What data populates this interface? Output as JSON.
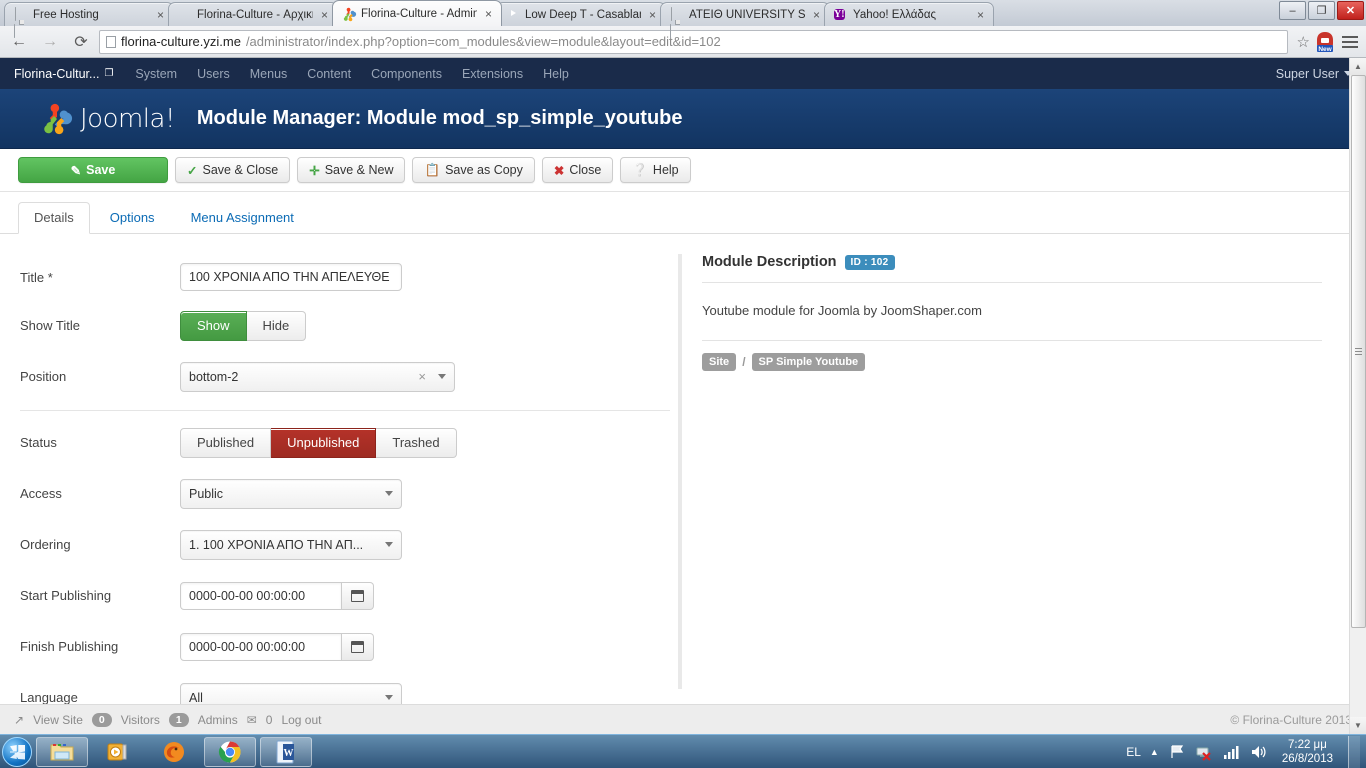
{
  "browser": {
    "tabs": [
      {
        "title": "Free Hosting",
        "icon": "document-favicon",
        "active": false
      },
      {
        "title": "Florina-Culture - Αρχικη",
        "icon": "opera-favicon",
        "active": false
      },
      {
        "title": "Florina-Culture - Administ",
        "icon": "joomla-favicon",
        "active": true
      },
      {
        "title": "Low Deep T - Casablanca",
        "icon": "youtube-favicon",
        "active": false
      },
      {
        "title": "ΑΤΕΙΘ UNIVERSITY STUDE",
        "icon": "document-favicon",
        "active": false
      },
      {
        "title": "Yahoo! Ελλάδας",
        "icon": "yahoo-favicon",
        "active": false
      }
    ],
    "close_label": "×",
    "window_controls": {
      "minimize": "–",
      "maximize": "❐",
      "close": "✕"
    },
    "nav": {
      "back": "←",
      "forward": "→",
      "reload": "⟳"
    },
    "url_strong": "florina-culture.yzi.me",
    "url_dim": "/administrator/index.php?option=com_modules&view=module&layout=edit&id=102",
    "star": "☆",
    "extension_badge": "New"
  },
  "joomla": {
    "topbar": {
      "site_name": "Florina-Cultur...",
      "menus": [
        "System",
        "Users",
        "Menus",
        "Content",
        "Components",
        "Extensions",
        "Help"
      ],
      "user": "Super User"
    },
    "header": {
      "logo_text": "Joomla!",
      "title": "Module Manager: Module mod_sp_simple_youtube"
    },
    "toolbar": [
      {
        "label": "Save",
        "icon": "save-icon",
        "primary": true
      },
      {
        "label": "Save & Close",
        "icon": "check-icon"
      },
      {
        "label": "Save & New",
        "icon": "plus-icon"
      },
      {
        "label": "Save as Copy",
        "icon": "copy-icon"
      },
      {
        "label": "Close",
        "icon": "close-circle-icon"
      },
      {
        "label": "Help",
        "icon": "help-circle-icon"
      }
    ],
    "tabs": [
      {
        "label": "Details",
        "active": true
      },
      {
        "label": "Options",
        "active": false
      },
      {
        "label": "Menu Assignment",
        "active": false
      }
    ],
    "form": {
      "title": {
        "label": "Title *",
        "value": "100 ΧΡΟΝΙΑ ΑΠΟ ΤΗΝ ΑΠΕΛΕΥΘΕ"
      },
      "show_title": {
        "label": "Show Title",
        "options": [
          "Show",
          "Hide"
        ],
        "selected": "Show"
      },
      "position": {
        "label": "Position",
        "value": "bottom-2",
        "clear": "×"
      },
      "status": {
        "label": "Status",
        "options": [
          "Published",
          "Unpublished",
          "Trashed"
        ],
        "selected": "Unpublished"
      },
      "access": {
        "label": "Access",
        "value": "Public"
      },
      "ordering": {
        "label": "Ordering",
        "value": "1. 100 ΧΡΟΝΙΑ ΑΠΟ ΤΗΝ ΑΠ..."
      },
      "start_publishing": {
        "label": "Start Publishing",
        "value": "0000-00-00 00:00:00"
      },
      "finish_publishing": {
        "label": "Finish Publishing",
        "value": "0000-00-00 00:00:00"
      },
      "language": {
        "label": "Language",
        "value": "All"
      }
    },
    "description": {
      "heading": "Module Description",
      "id_badge": "ID : 102",
      "text": "Youtube module for Joomla by JoomShaper.com",
      "tags": [
        "Site",
        "SP Simple Youtube"
      ],
      "separator": "/"
    },
    "footer": {
      "view_site": "View Site",
      "visitors_count": "0",
      "visitors_label": "Visitors",
      "admins_count": "1",
      "admins_label": "Admins",
      "messages": "0",
      "logout": "Log out",
      "copyright": "© Florina-Culture 2013"
    }
  },
  "taskbar": {
    "start": "windows-start-orb",
    "items": [
      "explorer-icon",
      "media-player-icon",
      "firefox-icon",
      "chrome-icon",
      "word-icon"
    ],
    "tray": {
      "language": "EL",
      "show_hidden": "▲",
      "flag_icon": "action-center-flag",
      "network_icon": "network-error",
      "signal_icon": "signal-bars",
      "volume_icon": "volume-speaker",
      "time": "7:22 μμ",
      "date": "26/8/2013"
    }
  }
}
